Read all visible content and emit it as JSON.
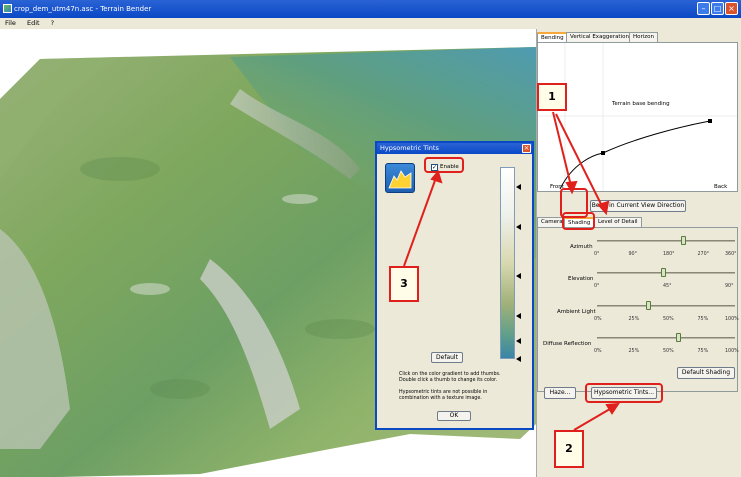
{
  "window": {
    "title": "crop_dem_utm47n.asc - Terrain Bender"
  },
  "menu": [
    "File",
    "Edit",
    "?"
  ],
  "panel": {
    "tabs_top": [
      "Bending",
      "Vertical Exaggeration",
      "Horizon"
    ],
    "bend_graph_label": "Terrain base bending",
    "front_label": "Front",
    "back_label": "Back",
    "bend_button": "Bend in Current View Direction",
    "tabs_bottom": [
      "Camera",
      "Shading",
      "Level of Detail"
    ],
    "sliders": [
      {
        "label": "Azimuth",
        "ticks": [
          "0°",
          "90°",
          "180°",
          "270°",
          "360°"
        ],
        "value_fraction": 0.62
      },
      {
        "label": "Elevation",
        "ticks": [
          "0°",
          "45°",
          "90°"
        ],
        "value_fraction": 0.48
      },
      {
        "label": "Ambient Light",
        "ticks": [
          "0%",
          "25%",
          "50%",
          "75%",
          "100%"
        ],
        "value_fraction": 0.37
      },
      {
        "label": "Diffuse Reflection",
        "ticks": [
          "0%",
          "25%",
          "50%",
          "75%",
          "100%"
        ],
        "value_fraction": 0.59
      }
    ],
    "default_shading": "Default Shading",
    "haze_button": "Haze...",
    "hypso_button": "Hypsometric Tints..."
  },
  "dialog": {
    "title": "Hypsometric Tints",
    "enable_label": "Enable",
    "default_button": "Default",
    "help1": "Click on the color gradient to add thumbs.",
    "help2": "Double click a thumb to change its color.",
    "help3": "Hypsometric tints are not possible in",
    "help4": "combination with a texture image.",
    "ok_button": "OK"
  },
  "callouts": {
    "one": "1",
    "two": "2",
    "three": "3"
  },
  "colors": {
    "titlebar": "#0a48c6",
    "callout_red": "#e0201c",
    "panel_bg": "#ece9d8"
  }
}
